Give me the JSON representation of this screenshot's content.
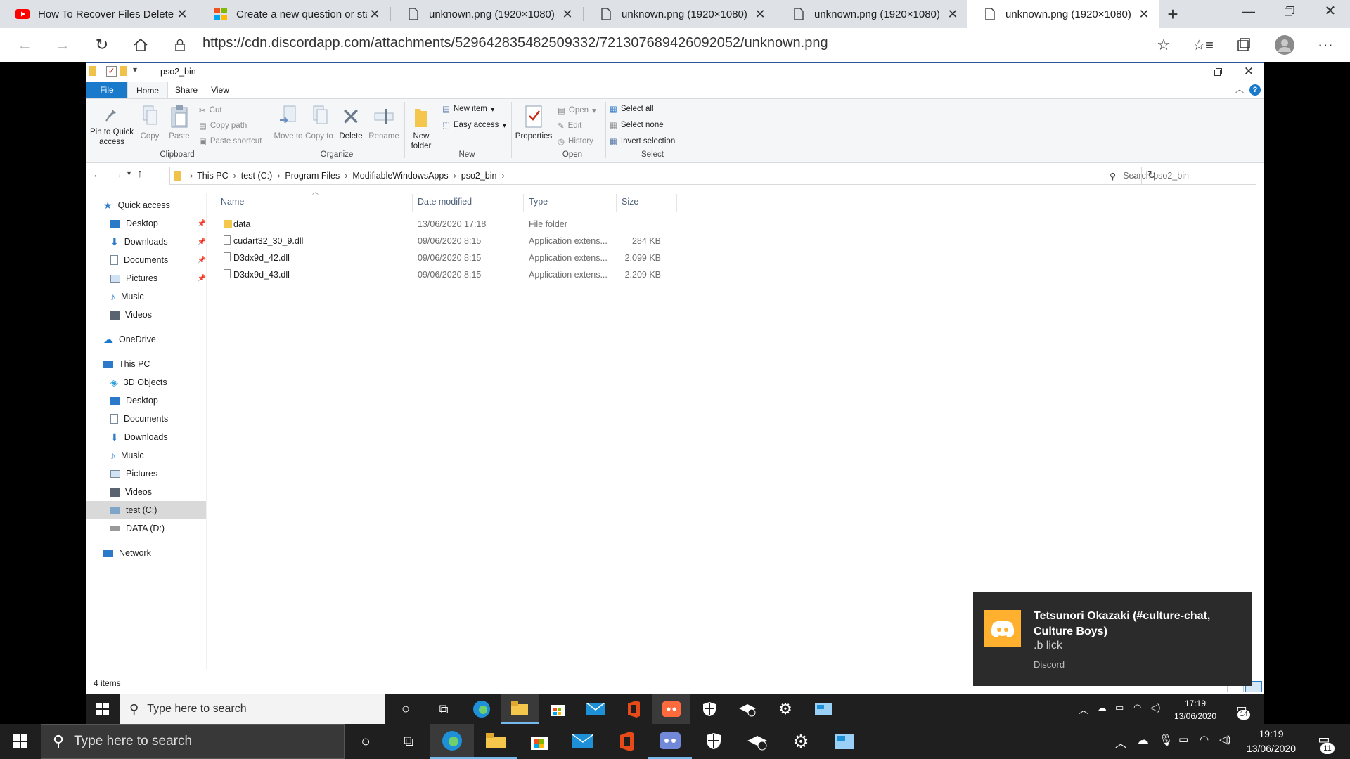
{
  "browser": {
    "tabs": [
      {
        "title": "How To Recover Files Deleted",
        "icon": "youtube-icon",
        "active": false
      },
      {
        "title": "Create a new question or sta",
        "icon": "microsoft-icon",
        "active": false
      },
      {
        "title": "unknown.png (1920×1080)",
        "icon": "page-icon",
        "active": false
      },
      {
        "title": "unknown.png (1920×1080)",
        "icon": "page-icon",
        "active": false
      },
      {
        "title": "unknown.png (1920×1080)",
        "icon": "page-icon",
        "active": false
      },
      {
        "title": "unknown.png (1920×1080)",
        "icon": "page-icon",
        "active": true
      }
    ],
    "url": "https://cdn.discordapp.com/attachments/529642835482509332/721307689426092052/unknown.png"
  },
  "explorer": {
    "title": "pso2_bin",
    "ribbon_tabs": [
      "File",
      "Home",
      "Share",
      "View"
    ],
    "clipboard": {
      "pin": "Pin to Quick access",
      "copy": "Copy",
      "paste": "Paste",
      "cut": "Cut",
      "copy_path": "Copy path",
      "paste_shortcut": "Paste shortcut",
      "label": "Clipboard"
    },
    "organize": {
      "move_to": "Move to",
      "copy_to": "Copy to",
      "delete": "Delete",
      "rename": "Rename",
      "label": "Organize"
    },
    "new": {
      "new_folder": "New folder",
      "new_item": "New item",
      "easy_access": "Easy access",
      "label": "New"
    },
    "open": {
      "properties": "Properties",
      "open": "Open",
      "edit": "Edit",
      "history": "History",
      "label": "Open"
    },
    "select": {
      "select_all": "Select all",
      "select_none": "Select none",
      "invert": "Invert selection",
      "label": "Select"
    },
    "breadcrumb": [
      "This PC",
      "test (C:)",
      "Program Files",
      "ModifiableWindowsApps",
      "pso2_bin"
    ],
    "search_placeholder": "Search pso2_bin",
    "nav": {
      "quick_access": "Quick access",
      "qa_items": [
        "Desktop",
        "Downloads",
        "Documents",
        "Pictures",
        "Music",
        "Videos"
      ],
      "onedrive": "OneDrive",
      "this_pc": "This PC",
      "pc_items": [
        "3D Objects",
        "Desktop",
        "Documents",
        "Downloads",
        "Music",
        "Pictures",
        "Videos",
        "test (C:)",
        "DATA (D:)"
      ],
      "network": "Network"
    },
    "columns": {
      "name": "Name",
      "date": "Date modified",
      "type": "Type",
      "size": "Size"
    },
    "files": [
      {
        "name": "data",
        "date": "13/06/2020 17:18",
        "type": "File folder",
        "size": ""
      },
      {
        "name": "cudart32_30_9.dll",
        "date": "09/06/2020 8:15",
        "type": "Application extens...",
        "size": "284 KB"
      },
      {
        "name": "D3dx9d_42.dll",
        "date": "09/06/2020 8:15",
        "type": "Application extens...",
        "size": "2.099 KB"
      },
      {
        "name": "D3dx9d_43.dll",
        "date": "09/06/2020 8:15",
        "type": "Application extens...",
        "size": "2.209 KB"
      }
    ],
    "status": "4 items"
  },
  "notification": {
    "title": "Tetsunori Okazaki (#culture-chat, Culture Boys)",
    "body": ".b lick",
    "app": "Discord"
  },
  "inner_taskbar": {
    "search_placeholder": "Type here to search",
    "time": "17:19",
    "date": "13/06/2020",
    "notifications": "14"
  },
  "outer_taskbar": {
    "search_placeholder": "Type here to search",
    "time": "19:19",
    "date": "13/06/2020",
    "notifications": "11"
  },
  "colors": {
    "accent": "#2b579a",
    "file_tab": "#1979ca",
    "tab_bar": "#dee1e6",
    "taskbar": "#1f1f1f",
    "toast": "#2b2b2b",
    "discord": "#ffb02e"
  }
}
